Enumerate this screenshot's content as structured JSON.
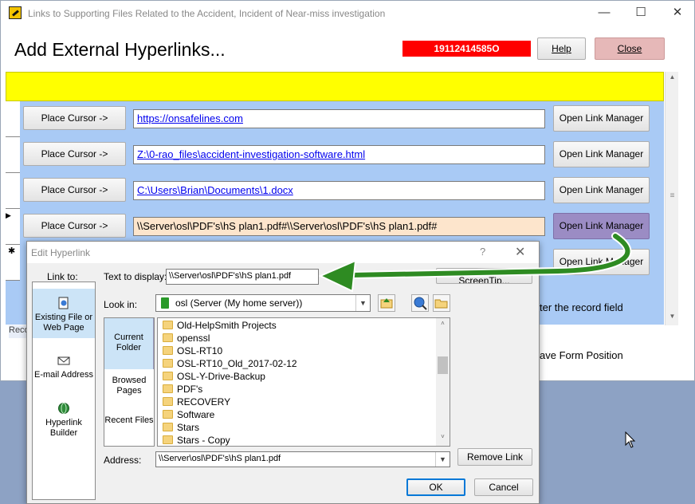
{
  "window": {
    "title": "Links to Supporting Files Related to the Accident, Incident of Near-miss investigation",
    "minimize_glyph": "—",
    "maximize_glyph": "☐",
    "close_glyph": "✕"
  },
  "header": {
    "title": "Add External Hyperlinks...",
    "record_id": "19112414585O",
    "help_label": "Help",
    "close_label": "Close"
  },
  "rows": [
    {
      "place_label": "Place Cursor ->",
      "link": "https://onsafelines.com",
      "manager_label": "Open Link Manager"
    },
    {
      "place_label": "Place Cursor ->",
      "link": "Z:\\0-rao_files\\accident-investigation-software.html",
      "manager_label": "Open Link Manager"
    },
    {
      "place_label": "Place Cursor ->",
      "link": "C:\\Users\\Brian\\Documents\\1.docx",
      "manager_label": "Open Link Manager"
    },
    {
      "place_label": "Place Cursor ->",
      "link": "\\\\Server\\osl\\PDF's\\hS plan1.pdf#\\\\Server\\osl\\PDF's\\hS plan1.pdf#",
      "manager_label": "Open Link Manager"
    },
    {
      "manager_label": "Open Link Manager"
    }
  ],
  "record_selectors": [
    "",
    "",
    "",
    "▶",
    "✱"
  ],
  "record_nav_label": "Reco",
  "enter_record_hint": "ter the record field",
  "save_form_position": "ave Form Position",
  "dialog": {
    "title": "Edit Hyperlink",
    "help_glyph": "?",
    "close_glyph": "✕",
    "link_to_label": "Link to:",
    "link_to_items": [
      "Existing File or Web Page",
      "E-mail Address",
      "Hyperlink Builder"
    ],
    "text_to_display_label": "Text to display:",
    "text_to_display_value": "\\\\Server\\osl\\PDF's\\hS plan1.pdf",
    "screentip_label": "ScreenTip...",
    "look_in_label": "Look in:",
    "look_in_value": "osl (Server (My home server))",
    "nav_items": [
      "Current Folder",
      "Browsed Pages",
      "Recent Files"
    ],
    "files": [
      "Old-HelpSmith Projects",
      "openssl",
      "OSL-RT10",
      "OSL-RT10_Old_2017-02-12",
      "OSL-Y-Drive-Backup",
      "PDF's",
      "RECOVERY",
      "Software",
      "Stars",
      "Stars - Copy"
    ],
    "address_label": "Address:",
    "address_value": "\\\\Server\\osl\\PDF's\\hS plan1.pdf",
    "remove_link_label": "Remove Link",
    "ok_label": "OK",
    "cancel_label": "Cancel"
  },
  "colors": {
    "record_id_bg": "#ff0000",
    "yellow_band": "#ffff00",
    "subform_bg": "#a9caf5",
    "active_field": "#fde5cc",
    "active_manager": "#9b8cc4",
    "arrow": "#2e8b22"
  }
}
